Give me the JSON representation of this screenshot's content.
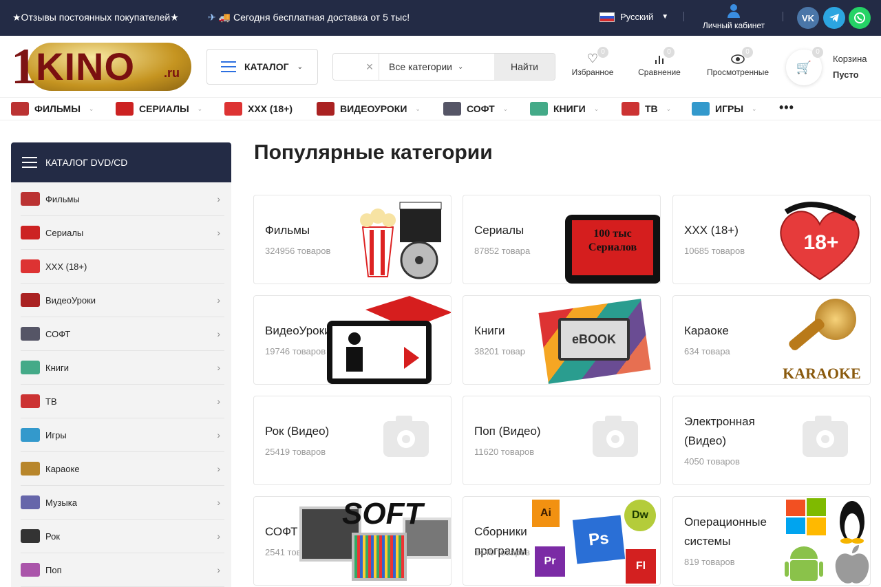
{
  "topbar": {
    "promo_reviews": "★Отзывы постоянных покупателей★",
    "promo_delivery": "Сегодня бесплатная доставка от 5 тыс!",
    "language": "Русский",
    "account": "Личный кабинет",
    "social": [
      "VK",
      "TG",
      "WA"
    ]
  },
  "header": {
    "logo_one": "1",
    "logo_word": "KINO",
    "logo_ru": ".ru",
    "catalog_label": "КАТАЛОГ",
    "search_placeholder": "",
    "search_category": "Все категории",
    "search_button": "Найти",
    "favorites": {
      "label": "Избранное",
      "count": "0"
    },
    "compare": {
      "label": "Сравнение",
      "count": "0"
    },
    "viewed": {
      "label": "Просмотренные",
      "count": "0"
    },
    "cart": {
      "label": "Корзина",
      "status": "Пусто",
      "count": "0"
    }
  },
  "nav": {
    "items": [
      {
        "label": "ФИЛЬМЫ",
        "icon": "film-icon",
        "color": "#b33"
      },
      {
        "label": "СЕРИАЛЫ",
        "icon": "tv-series-icon",
        "color": "#c22"
      },
      {
        "label": "XXX (18+)",
        "icon": "heart-18-icon",
        "color": "#d33"
      },
      {
        "label": "ВИДЕОУРОКИ",
        "icon": "lesson-icon",
        "color": "#a22"
      },
      {
        "label": "СОФТ",
        "icon": "software-icon",
        "color": "#556"
      },
      {
        "label": "КНИГИ",
        "icon": "book-icon",
        "color": "#4a8"
      },
      {
        "label": "ТВ",
        "icon": "tv-icon",
        "color": "#c33"
      },
      {
        "label": "ИГРЫ",
        "icon": "gamepad-icon",
        "color": "#39c"
      }
    ],
    "more": "•••"
  },
  "sidebar": {
    "title": "КАТАЛОГ DVD/CD",
    "items": [
      {
        "label": "Фильмы",
        "color": "#b33",
        "arrow": true
      },
      {
        "label": "Сериалы",
        "color": "#c22",
        "arrow": true
      },
      {
        "label": "XXX (18+)",
        "color": "#d33",
        "arrow": false
      },
      {
        "label": "ВидеоУроки",
        "color": "#a22",
        "arrow": true
      },
      {
        "label": "СОФТ",
        "color": "#556",
        "arrow": true
      },
      {
        "label": "Книги",
        "color": "#4a8",
        "arrow": true
      },
      {
        "label": "ТВ",
        "color": "#c33",
        "arrow": true
      },
      {
        "label": "Игры",
        "color": "#39c",
        "arrow": true
      },
      {
        "label": "Караоке",
        "color": "#b8862b",
        "arrow": true
      },
      {
        "label": "Музыка",
        "color": "#66a",
        "arrow": true
      },
      {
        "label": "Рок",
        "color": "#333",
        "arrow": true
      },
      {
        "label": "Поп",
        "color": "#a5a",
        "arrow": true
      }
    ]
  },
  "main": {
    "title": "Популярные категории",
    "cards": [
      {
        "name": "Фильмы",
        "count": "324956 товаров",
        "image": "popcorn-film-image"
      },
      {
        "name": "Сериалы",
        "count": "87852 товара",
        "image": "tv-series-image",
        "pic_text": "100 тыс Сериалов"
      },
      {
        "name": "XXX (18+)",
        "count": "10685 товаров",
        "image": "heart-18-image",
        "pic_text": "18+"
      },
      {
        "name": "ВидеоУроки",
        "count": "19746 товаров",
        "image": "video-lesson-image"
      },
      {
        "name": "Книги",
        "count": "38201 товар",
        "image": "ebook-image",
        "pic_text": "eBOOK"
      },
      {
        "name": "Караоке",
        "count": "634 товара",
        "image": "karaoke-mic-image",
        "pic_text": "KARAOKE"
      },
      {
        "name": "Рок (Видео)",
        "count": "25419 товаров",
        "image": "placeholder-camera-icon"
      },
      {
        "name": "Поп (Видео)",
        "count": "11620 товаров",
        "image": "placeholder-camera-icon"
      },
      {
        "name": "Электронная (Видео)",
        "count": "4050 товаров",
        "image": "placeholder-camera-icon"
      },
      {
        "name": "СОФТ",
        "count": "2541 товар",
        "image": "software-image",
        "pic_text": "SOFT"
      },
      {
        "name": "Сборники программ",
        "count": "1440 товаров",
        "image": "adobe-apps-image",
        "pic_text": "Ai Ps Dw Pr Fl"
      },
      {
        "name": "Операционные системы",
        "count": "819 товаров",
        "image": "os-logos-image"
      }
    ]
  }
}
